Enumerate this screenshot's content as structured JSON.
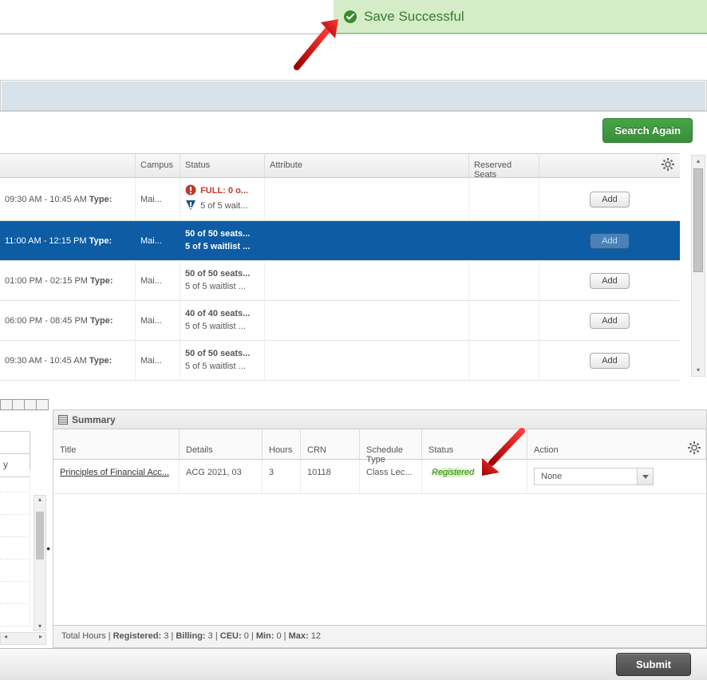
{
  "notification": {
    "text": "Save Successful"
  },
  "search_again_label": "Search Again",
  "columns": {
    "campus": "Campus",
    "status": "Status",
    "attribute": "Attribute",
    "reserved": "Reserved Seats"
  },
  "rows": [
    {
      "time": "09:30 AM - 10:45 AM",
      "type_label": "Type:",
      "campus": "Mai...",
      "status_full_prefix": "FULL: ",
      "status_full_rest": "0 o...",
      "status_wait": "5 of 5 wait...",
      "add": "Add",
      "selected": false,
      "full": true
    },
    {
      "time": "11:00 AM - 12:15 PM",
      "type_label": "Type:",
      "campus": "Mai...",
      "status_seats": "50 of 50 seats...",
      "status_wait": "5 of 5 waitlist ...",
      "add": "Add",
      "selected": true
    },
    {
      "time": "01:00 PM - 02:15 PM",
      "type_label": "Type:",
      "campus": "Mai...",
      "status_seats": "50 of 50 seats...",
      "status_wait": "5 of 5 waitlist ...",
      "add": "Add",
      "selected": false
    },
    {
      "time": "06:00 PM - 08:45 PM",
      "type_label": "Type:",
      "campus": "Mai...",
      "status_seats": "40 of 40 seats...",
      "status_wait": "5 of 5 waitlist ...",
      "add": "Add",
      "selected": false
    },
    {
      "time": "09:30 AM - 10:45 AM",
      "type_label": "Type:",
      "campus": "Mai...",
      "status_seats": "50 of 50 seats...",
      "status_wait": "5 of 5 waitlist ...",
      "add": "Add",
      "selected": false
    }
  ],
  "summary": {
    "title": "Summary",
    "columns": {
      "title": "Title",
      "details": "Details",
      "hours": "Hours",
      "crn": "CRN",
      "stype": "Schedule Type",
      "status": "Status",
      "action": "Action"
    },
    "row": {
      "title": "Principles of Financial Acc...",
      "details": "ACG 2021, 03",
      "hours": "3",
      "crn": "10118",
      "stype": "Class Lec...",
      "status": "Registered",
      "action": "None"
    },
    "footer": {
      "lead": "Total Hours | ",
      "reg_lbl": "Registered:",
      "reg_val": "3",
      "bill_lbl": "Billing:",
      "bill_val": "3",
      "ceu_lbl": "CEU:",
      "ceu_val": "0",
      "min_lbl": "Min:",
      "min_val": "0",
      "max_lbl": "Max:",
      "max_val": "12",
      "sep": " | "
    }
  },
  "left_label": "y",
  "dot": "•",
  "submit_label": "Submit"
}
